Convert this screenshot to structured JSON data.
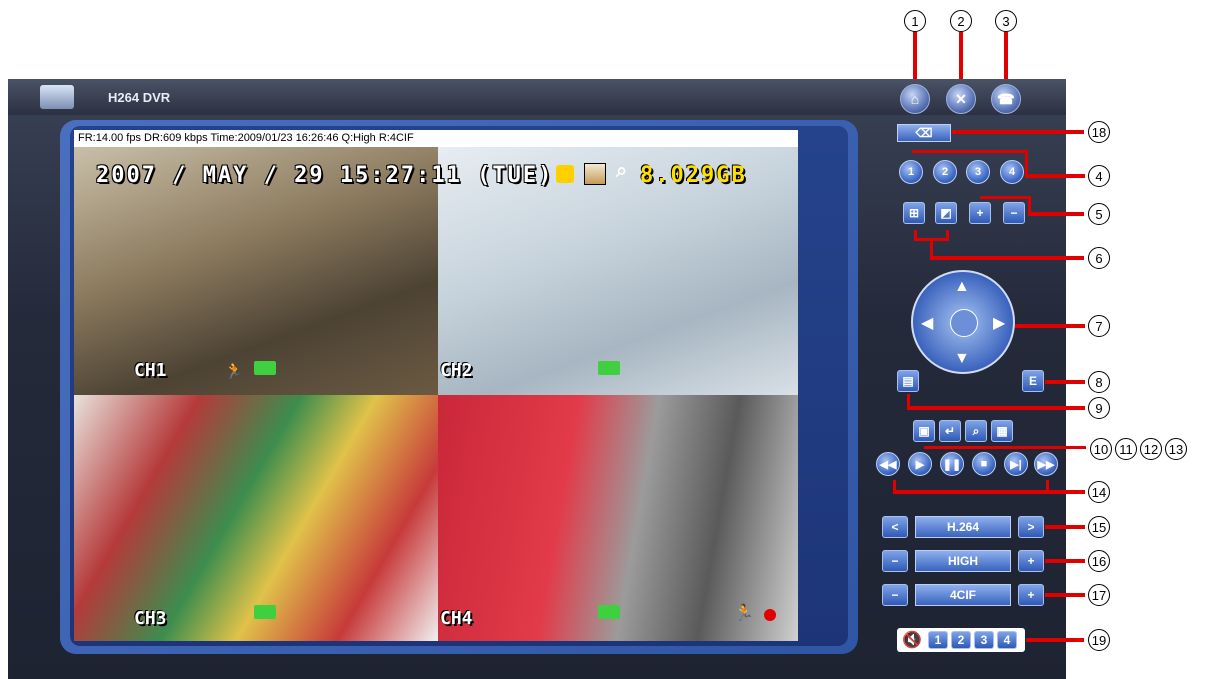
{
  "app": {
    "title": "H264 DVR"
  },
  "status_bar": "FR:14.00 fps  DR:609 kbps Time:2009/01/23 16:26:46 Q:High R:4CIF",
  "osd": {
    "datetime": "2007 / MAY / 29 15:27:11 (TUE)",
    "storage": "8.029GB"
  },
  "channels": [
    {
      "label": "CH1"
    },
    {
      "label": "CH2"
    },
    {
      "label": "CH3"
    },
    {
      "label": "CH4"
    }
  ],
  "channel_buttons": [
    "1",
    "2",
    "3",
    "4"
  ],
  "audio_channels": [
    "1",
    "2",
    "3",
    "4"
  ],
  "settings": {
    "codec": "H.264",
    "quality": "HIGH",
    "resolution": "4CIF"
  },
  "callouts": [
    "1",
    "2",
    "3",
    "4",
    "5",
    "6",
    "7",
    "8",
    "9",
    "10",
    "11",
    "12",
    "13",
    "14",
    "15",
    "16",
    "17",
    "18",
    "19"
  ],
  "colors": {
    "accent": "#3963bd",
    "callout_arrow": "#e00000",
    "storage_text": "#ffe000"
  },
  "icons": [
    "home-icon",
    "tools-icon",
    "network-icon",
    "key-icon",
    "lock-icon",
    "hdd-icon",
    "search-icon",
    "motion-icon",
    "camera-icon",
    "record-dot-icon",
    "speaker-mute-icon"
  ]
}
